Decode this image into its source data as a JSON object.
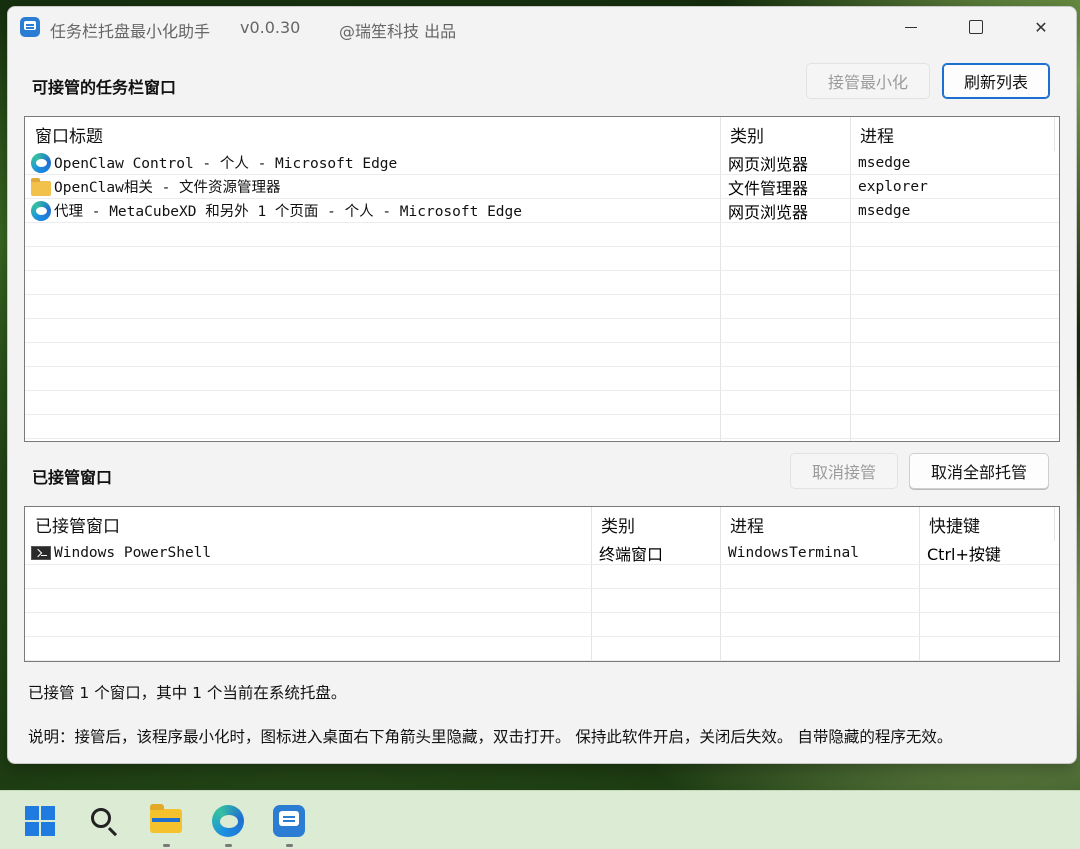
{
  "titlebar": {
    "app_name": "任务栏托盘最小化助手",
    "version": "v0.0.30",
    "credit": "@瑞笙科技 出品"
  },
  "available_section": {
    "title": "可接管的任务栏窗口",
    "minimize_button": "接管最小化",
    "refresh_button": "刷新列表",
    "columns": [
      "窗口标题",
      "类别",
      "进程"
    ],
    "rows": [
      {
        "icon": "edge-icon",
        "title": "OpenClaw Control - 个人 - Microsoft Edge",
        "category": "网页浏览器",
        "process": "msedge"
      },
      {
        "icon": "folder-icon",
        "title": "OpenClaw相关 - 文件资源管理器",
        "category": "文件管理器",
        "process": "explorer"
      },
      {
        "icon": "edge-icon",
        "title": "代理 - MetaCubeXD 和另外 1 个页面 - 个人 - Microsoft Edge",
        "category": "网页浏览器",
        "process": "msedge"
      }
    ]
  },
  "managed_section": {
    "title": "已接管窗口",
    "cancel_button": "取消接管",
    "cancel_all_button": "取消全部托管",
    "columns": [
      "已接管窗口",
      "类别",
      "进程",
      "快捷键"
    ],
    "rows": [
      {
        "icon": "powershell-icon",
        "title": "Windows PowerShell",
        "category": "终端窗口",
        "process": "WindowsTerminal",
        "hotkey": "Ctrl+按键"
      }
    ]
  },
  "status": {
    "summary": "已接管 1 个窗口，其中 1 个当前在系统托盘。",
    "note": "说明：接管后，该程序最小化时，图标进入桌面右下角箭头里隐藏，双击打开。 保持此软件开启，关闭后失效。 自带隐藏的程序无效。"
  },
  "taskbar": {
    "items": [
      "start-icon",
      "search-icon",
      "file-explorer-icon",
      "edge-icon",
      "tray-helper-app-icon"
    ]
  },
  "colors": {
    "accent": "#1a6fd0",
    "window_bg": "#f3f3f3",
    "disabled_text": "#9b9b9b"
  }
}
